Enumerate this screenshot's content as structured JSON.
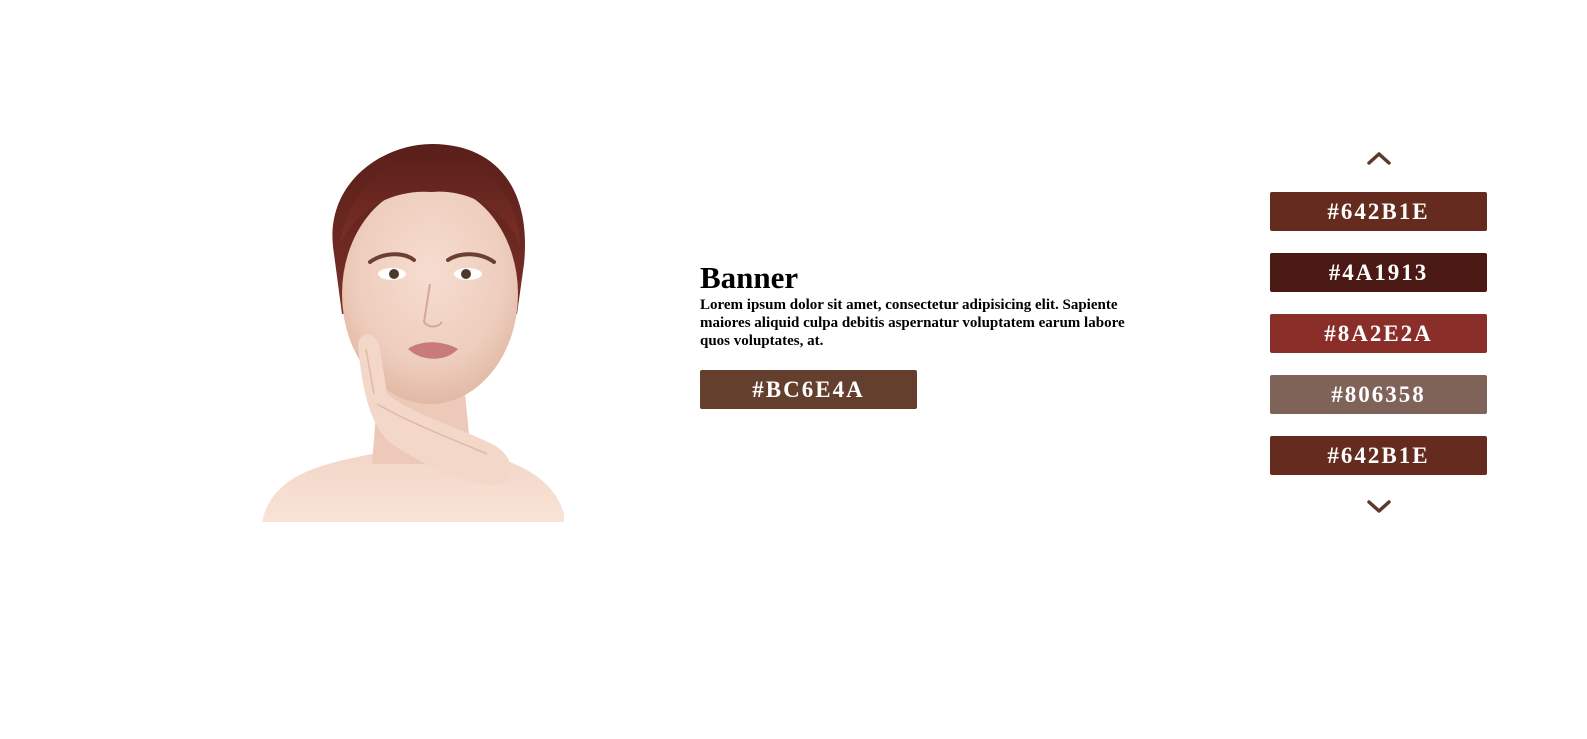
{
  "banner": {
    "title": "Banner",
    "text": "Lorem ipsum dolor sit amet, consectetur adipisicing elit. Sapiente maiores aliquid culpa debitis aspernatur voluptatem earum labore quos voluptates, at.",
    "selected_color_label": "#BC6E4A",
    "selected_color": "#643F2E"
  },
  "image": {
    "subject": "portrait of woman with dark red hair, hand on cheek",
    "hair_color": "#6a2a22"
  },
  "palette": {
    "up_icon": "chevron-up-icon",
    "down_icon": "chevron-down-icon",
    "arrow_color": "#5b3a2c",
    "swatches": [
      {
        "label": "#642B1E",
        "color": "#642B1E"
      },
      {
        "label": "#4A1913",
        "color": "#4A1913"
      },
      {
        "label": "#8A2E2A",
        "color": "#8A2E2A"
      },
      {
        "label": "#806358",
        "color": "#806358"
      },
      {
        "label": "#642B1E",
        "color": "#642B1E"
      }
    ]
  }
}
